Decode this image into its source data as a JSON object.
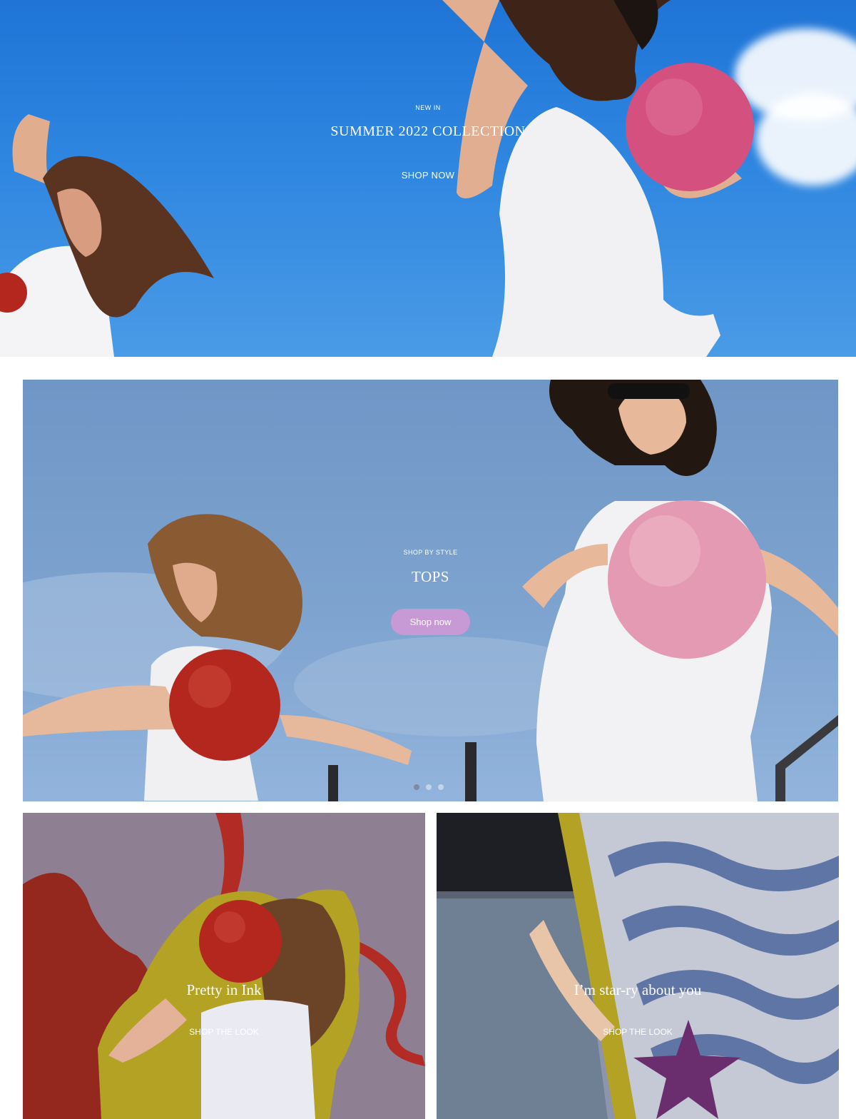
{
  "hero": {
    "eyebrow": "NEW IN",
    "title": "SUMMER 2022 COLLECTION",
    "cta": "SHOP NOW"
  },
  "slideshow": {
    "eyebrow": "SHOP BY STYLE",
    "title": "TOPS",
    "cta": "Shop now",
    "active_slide": 1,
    "slide_count": 3
  },
  "tiles": [
    {
      "title": "Pretty in Ink",
      "cta": "SHOP THE LOOK"
    },
    {
      "title": "I’m star-ry about you",
      "cta": "SHOP THE LOOK"
    }
  ],
  "colors": {
    "sky": "#2f86e0",
    "pill": "#c79ad6",
    "ball_pink": "#d4507f",
    "ball_red": "#b3271f",
    "star": "#6a2e6e"
  }
}
